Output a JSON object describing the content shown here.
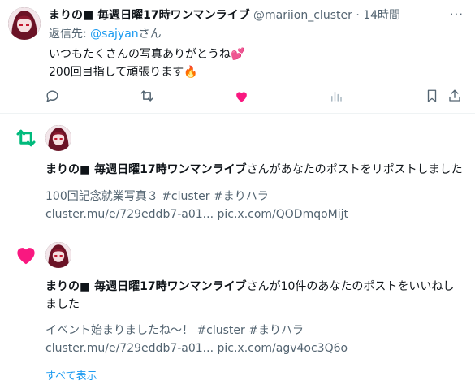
{
  "tweet": {
    "author_name": "まりの■ 毎週日曜17時ワンマンライブ",
    "handle": "@mariion_cluster",
    "separator": "·",
    "time": "14時間",
    "more": "···",
    "replying_prefix": "返信先: ",
    "replying_to": "@sajyan",
    "replying_suffix": "さん",
    "line1": "いつもたくさんの写真ありがとうね💕",
    "line2": "200回目指して頑張ります🔥",
    "actions": [
      "reply-icon",
      "retweet-icon",
      "like-icon",
      "views-icon",
      "bookmark-icon",
      "share-icon"
    ],
    "like_color": "#f91880"
  },
  "notifications": [
    {
      "type": "repost",
      "icon": "retweet-icon",
      "icon_color": "#00ba7c",
      "actor": "まりの■ 毎週日曜17時ワンマンライブ",
      "action_text": "さんがあなたのポストをリポストしました",
      "body_line1": "100回記念就業写真３ #cluster #まりハラ",
      "body_line2": "cluster.mu/e/729eddb7-a01... pic.x.com/QODmqoMijt"
    },
    {
      "type": "like",
      "icon": "heart-icon",
      "icon_color": "#f91880",
      "actor": "まりの■ 毎週日曜17時ワンマンライブ",
      "action_text": "さんが10件のあなたのポストをいいねしました",
      "body_line1": "イベント始まりましたね〜！ #cluster #まりハラ",
      "body_line2": "cluster.mu/e/729eddb7-a01... pic.x.com/agv4oc3Q6o",
      "show_all": "すべて表示"
    }
  ],
  "colors": {
    "link": "#1d9bf0",
    "muted": "#536471",
    "text": "#0f1419"
  }
}
